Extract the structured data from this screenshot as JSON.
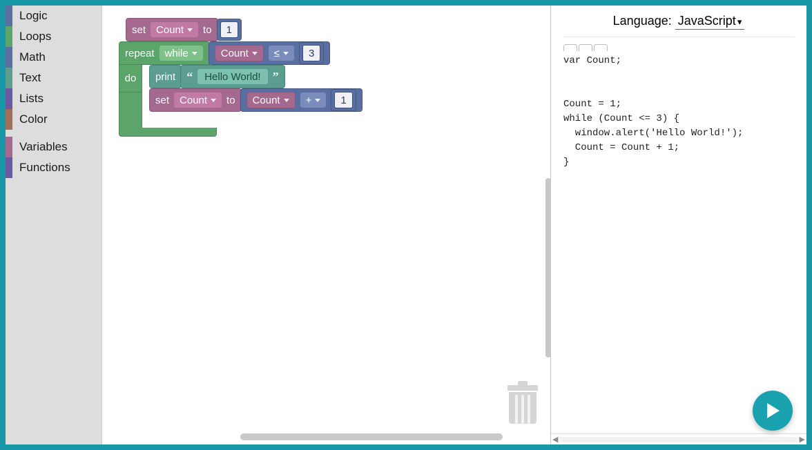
{
  "toolbox": {
    "categories": [
      {
        "label": "Logic",
        "color": "#5a6fa1"
      },
      {
        "label": "Loops",
        "color": "#5ba46a"
      },
      {
        "label": "Math",
        "color": "#5a6fa1"
      },
      {
        "label": "Text",
        "color": "#5b9d8e"
      },
      {
        "label": "Lists",
        "color": "#6a5aa1"
      },
      {
        "label": "Color",
        "color": "#a16e5a"
      }
    ],
    "extras": [
      {
        "label": "Variables",
        "color": "#a5688e"
      },
      {
        "label": "Functions",
        "color": "#6a5aa1"
      }
    ]
  },
  "blocks": {
    "set1": {
      "keyword_set": "set",
      "var": "Count",
      "keyword_to": "to",
      "value": "1"
    },
    "loop": {
      "keyword_repeat": "repeat",
      "mode": "while"
    },
    "compare": {
      "left_var": "Count",
      "op": "≤",
      "right": "3"
    },
    "loop_do": "do",
    "print": {
      "keyword": "print",
      "text": "Hello World!"
    },
    "set2": {
      "keyword_set": "set",
      "var": "Count",
      "keyword_to": "to"
    },
    "arith": {
      "left_var": "Count",
      "op": "+",
      "right": "1"
    }
  },
  "codepane": {
    "language_label": "Language:",
    "language_value": "JavaScript",
    "code": "var Count;\n\n\nCount = 1;\nwhile (Count <= 3) {\n  window.alert('Hello World!');\n  Count = Count + 1;\n}"
  }
}
